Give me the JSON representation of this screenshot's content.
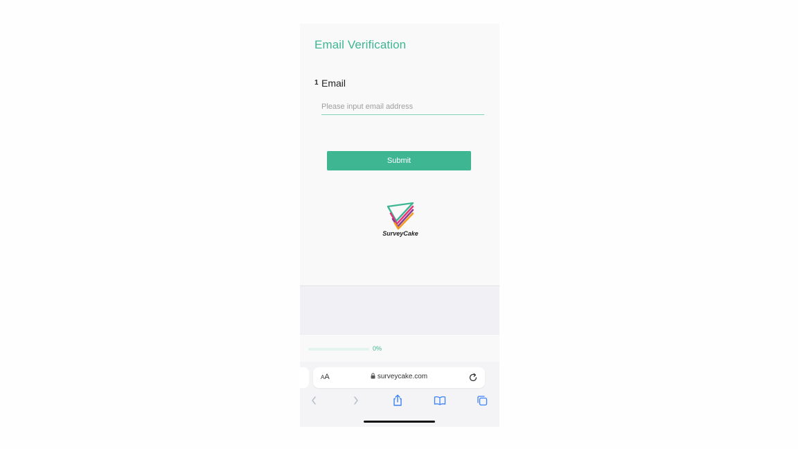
{
  "page": {
    "title": "Email Verification"
  },
  "question": {
    "number": "1",
    "label": "Email",
    "placeholder": "Please input email address",
    "value": ""
  },
  "form": {
    "submit_label": "Submit"
  },
  "brand": {
    "name": "SurveyCake",
    "accent_color": "#3db691"
  },
  "progress": {
    "percent": 0,
    "label": "0%"
  },
  "browser": {
    "aa_label_small": "A",
    "aa_label_large": "A",
    "url": "surveycake.com",
    "icons": {
      "lock": "lock-icon",
      "reload": "reload-icon",
      "back": "chevron-left-icon",
      "forward": "chevron-right-icon",
      "share": "share-icon",
      "bookmarks": "book-icon",
      "tabs": "tabs-icon"
    }
  }
}
